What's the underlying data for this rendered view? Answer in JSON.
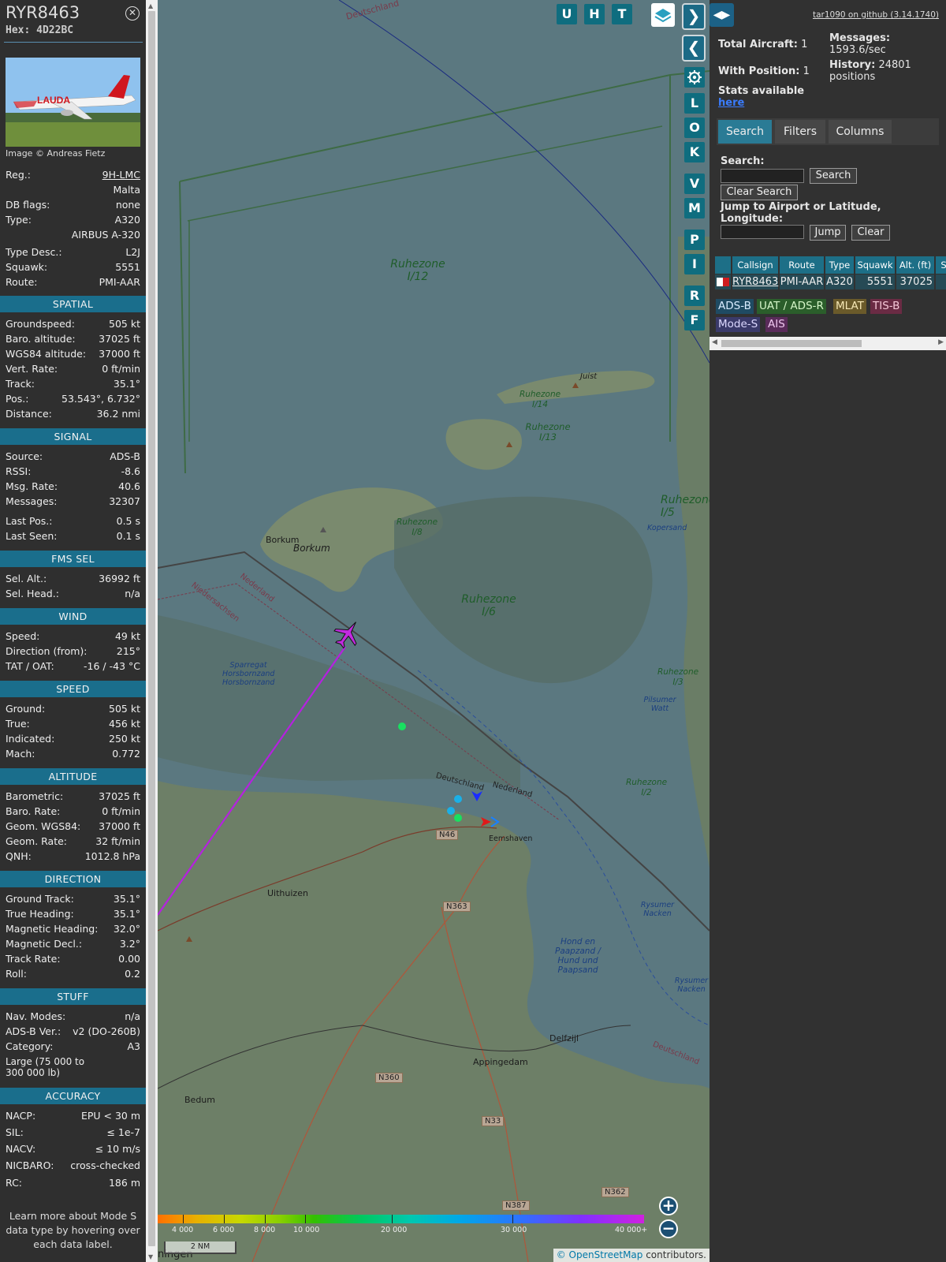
{
  "aircraft": {
    "callsign": "RYR8463",
    "hex_label": "Hex:",
    "hex": "4D22BC",
    "image_credit": "Image © Andreas Fietz",
    "photo_livery": "LAUDA"
  },
  "info_rows": {
    "reg": {
      "k": "Reg.:",
      "v": "9H-LMC"
    },
    "country": {
      "v": "Malta"
    },
    "dbflags": {
      "k": "DB flags:",
      "v": "none"
    },
    "type": {
      "k": "Type:",
      "v": "A320"
    },
    "typename": {
      "v": "AIRBUS A-320"
    },
    "typedesc": {
      "k": "Type Desc.:",
      "v": "L2J"
    },
    "squawk": {
      "k": "Squawk:",
      "v": "5551"
    },
    "route": {
      "k": "Route:",
      "v": "PMI-AAR"
    }
  },
  "sections": {
    "spatial": {
      "title": "SPATIAL",
      "rows": [
        {
          "k": "Groundspeed:",
          "v": "505 kt"
        },
        {
          "k": "Baro. altitude:",
          "v": "37025 ft"
        },
        {
          "k": "WGS84 altitude:",
          "v": "37000 ft"
        },
        {
          "k": "Vert. Rate:",
          "v": "0 ft/min"
        },
        {
          "k": "Track:",
          "v": "35.1°"
        },
        {
          "k": "Pos.:",
          "v": "53.543°, 6.732°"
        },
        {
          "k": "Distance:",
          "v": "36.2 nmi"
        }
      ]
    },
    "signal": {
      "title": "SIGNAL",
      "rows": [
        {
          "k": "Source:",
          "v": "ADS-B"
        },
        {
          "k": "RSSI:",
          "v": "-8.6"
        },
        {
          "k": "Msg. Rate:",
          "v": "40.6"
        },
        {
          "k": "Messages:",
          "v": "32307"
        },
        {
          "k": "Last Pos.:",
          "v": "0.5 s"
        },
        {
          "k": "Last Seen:",
          "v": "0.1 s"
        }
      ]
    },
    "fms": {
      "title": "FMS SEL",
      "rows": [
        {
          "k": "Sel. Alt.:",
          "v": "36992 ft"
        },
        {
          "k": "Sel. Head.:",
          "v": "n/a"
        }
      ]
    },
    "wind": {
      "title": "WIND",
      "rows": [
        {
          "k": "Speed:",
          "v": "49 kt"
        },
        {
          "k": "Direction (from):",
          "v": "215°"
        },
        {
          "k": "TAT / OAT:",
          "v": "-16 / -43 °C"
        }
      ]
    },
    "speed": {
      "title": "SPEED",
      "rows": [
        {
          "k": "Ground:",
          "v": "505 kt"
        },
        {
          "k": "True:",
          "v": "456 kt"
        },
        {
          "k": "Indicated:",
          "v": "250 kt"
        },
        {
          "k": "Mach:",
          "v": "0.772"
        }
      ]
    },
    "altitude": {
      "title": "ALTITUDE",
      "rows": [
        {
          "k": "Barometric:",
          "v": "37025 ft"
        },
        {
          "k": "Baro. Rate:",
          "v": "0 ft/min"
        },
        {
          "k": "Geom. WGS84:",
          "v": "37000 ft"
        },
        {
          "k": "Geom. Rate:",
          "v": "32 ft/min"
        },
        {
          "k": "QNH:",
          "v": "1012.8 hPa"
        }
      ]
    },
    "direction": {
      "title": "DIRECTION",
      "rows": [
        {
          "k": "Ground Track:",
          "v": "35.1°"
        },
        {
          "k": "True Heading:",
          "v": "35.1°"
        },
        {
          "k": "Magnetic Heading:",
          "v": "32.0°"
        },
        {
          "k": "Magnetic Decl.:",
          "v": "3.2°"
        },
        {
          "k": "Track Rate:",
          "v": "0.00"
        },
        {
          "k": "Roll:",
          "v": "0.2"
        }
      ]
    },
    "stuff": {
      "title": "STUFF",
      "rows": [
        {
          "k": "Nav. Modes:",
          "v": "n/a"
        },
        {
          "k": "ADS-B Ver.:",
          "v": "v2 (DO-260B)"
        },
        {
          "k": "Category:",
          "v": "A3"
        }
      ],
      "category_desc_1": "Large (75 000 to",
      "category_desc_2": "300 000 lb)"
    },
    "accuracy": {
      "title": "ACCURACY",
      "rows": [
        {
          "k": "NACP:",
          "v": "EPU < 30 m"
        },
        {
          "k": "SIL:",
          "v": "≤ 1e-7"
        },
        {
          "k": "NACV:",
          "v": "≤ 10 m/s"
        },
        {
          "k": "NICBARO:",
          "v": "cross-checked"
        },
        {
          "k": "RC:",
          "v": "186 m"
        }
      ]
    }
  },
  "footnote": {
    "l1": "Learn more about Mode S",
    "l2": "data type by hovering over",
    "l3": "each data label."
  },
  "map": {
    "top_buttons": [
      "U",
      "H",
      "T"
    ],
    "side_buttons": [
      "L",
      "O",
      "K",
      "V",
      "M",
      "P",
      "I",
      "R",
      "F"
    ],
    "labels": {
      "deutschland": "Deutschland",
      "nederland": "Nederland",
      "niedersachsen": "Niedersachsen",
      "borkum_small": "Borkum",
      "borkum": "Borkum",
      "juist": "Juist",
      "eemshaven": "Eemshaven",
      "uithuizen": "Uithuizen",
      "delfzijl": "Delfzijl",
      "appingedam": "Appingedam",
      "bedum": "Bedum",
      "kopersand": "Kopersand",
      "pilsumer": "Pilsumer Watt",
      "rysumer": "Rysumer Nacken",
      "rysumer2": "Rysumer Nacken",
      "hond": "Hond en Paapzand / Hund und Paapsand",
      "sparregat": "Sparregat Horsbornzand Horsbornzand",
      "ningen": "ningen"
    },
    "zones": {
      "z12": "Ruhezone I/12",
      "z6": "Ruhezone I/6",
      "z14": "Ruhezone I/14",
      "z13": "Ruhezone I/13",
      "z8": "Ruhezone I/8",
      "z5": "Ruhezone I/5",
      "z3": "Ruhezone I/3",
      "z2": "Ruhezone I/2"
    },
    "roads": [
      "N46",
      "N363",
      "N360",
      "N33",
      "N387",
      "N362"
    ],
    "altitude_ticks": [
      "4 000",
      "6 000",
      "8 000",
      "10 000",
      "20 000",
      "30 000",
      "40 000+"
    ],
    "scale": "2 NM",
    "attribution_owner": "© OpenStreetMap",
    "attribution_rest": " contributors."
  },
  "right": {
    "github": "tar1090 on github (3.14.1740)",
    "total_label": "Total Aircraft:",
    "total": "1",
    "withpos_label": "With Position:",
    "withpos": "1",
    "messages_label": "Messages:",
    "messages": "1593.6/sec",
    "history_label": "History:",
    "history": "24801",
    "history_unit": "positions",
    "stats_text": "Stats available",
    "stats_link": "here",
    "tabs": [
      "Search",
      "Filters",
      "Columns"
    ],
    "search_label": "Search:",
    "search_button": "Search",
    "clear_search": "Clear Search",
    "jump_label": "Jump to Airport or Latitude, Longitude:",
    "jump_button": "Jump",
    "clear_button": "Clear",
    "columns": [
      "Callsign",
      "Route",
      "Type",
      "Squawk",
      "Alt. (ft)",
      "S"
    ],
    "row": {
      "callsign": "RYR8463",
      "route": "PMI-AAR",
      "type": "A320",
      "squawk": "5551",
      "alt": "37025"
    },
    "sources": [
      {
        "label": "ADS-B",
        "bg": "#1f4b63",
        "fg": "#d9ecff"
      },
      {
        "label": "UAT / ADS-R",
        "bg": "#2b5e2b",
        "fg": "#d5f5c8"
      },
      {
        "label": "MLAT",
        "bg": "#6a5a2a",
        "fg": "#f5e7b5"
      },
      {
        "label": "TIS-B",
        "bg": "#6a2b44",
        "fg": "#f5c8d8"
      },
      {
        "label": "Mode-S",
        "bg": "#3a3a6a",
        "fg": "#dcd8ff"
      },
      {
        "label": "AIS",
        "bg": "#5a2b5a",
        "fg": "#f0c8f0"
      }
    ]
  }
}
